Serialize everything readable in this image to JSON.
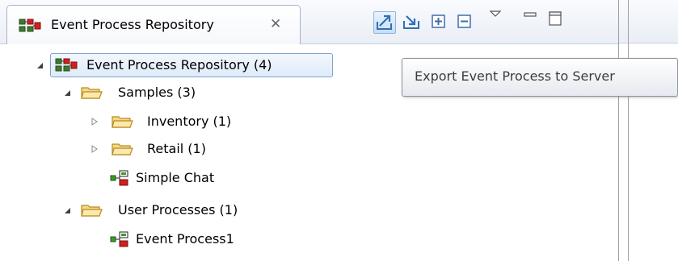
{
  "view": {
    "tab_title": "Event Process Repository",
    "tab_close_glyph": "✕",
    "toolbar": {
      "export_icon": "export-icon",
      "import_icon": "import-icon",
      "expand_icon": "expand-all-icon",
      "collapse_icon": "collapse-all-icon",
      "menu_icon": "view-menu-icon",
      "minimize_icon": "minimize-icon",
      "maximize_icon": "maximize-icon"
    }
  },
  "tree": {
    "root": {
      "label": "Event Process Repository (4)",
      "expanded": true,
      "selected": true,
      "icon": "repository-icon"
    },
    "items": [
      {
        "label": "Samples (3)",
        "depth": 1,
        "kind": "folder",
        "expanded": true,
        "icon": "folder-icon"
      },
      {
        "label": "Inventory (1)",
        "depth": 2,
        "kind": "folder",
        "expanded": false,
        "icon": "folder-icon"
      },
      {
        "label": "Retail (1)",
        "depth": 2,
        "kind": "folder",
        "expanded": false,
        "icon": "folder-icon"
      },
      {
        "label": "Simple Chat",
        "depth": 2,
        "kind": "process",
        "icon": "event-process-icon"
      },
      {
        "label": "User Processes (1)",
        "depth": 1,
        "kind": "folder",
        "expanded": true,
        "icon": "folder-icon"
      },
      {
        "label": "Event Process1",
        "depth": 2,
        "kind": "process",
        "icon": "event-process-icon"
      }
    ]
  },
  "tooltip": {
    "text": "Export Event Process to Server"
  },
  "colors": {
    "selection_border": "#7da2ce",
    "selection_fill": "#dfebf9",
    "folder": "#f2c75c",
    "process_green": "#3a9b2a",
    "process_red": "#d21f1f"
  }
}
